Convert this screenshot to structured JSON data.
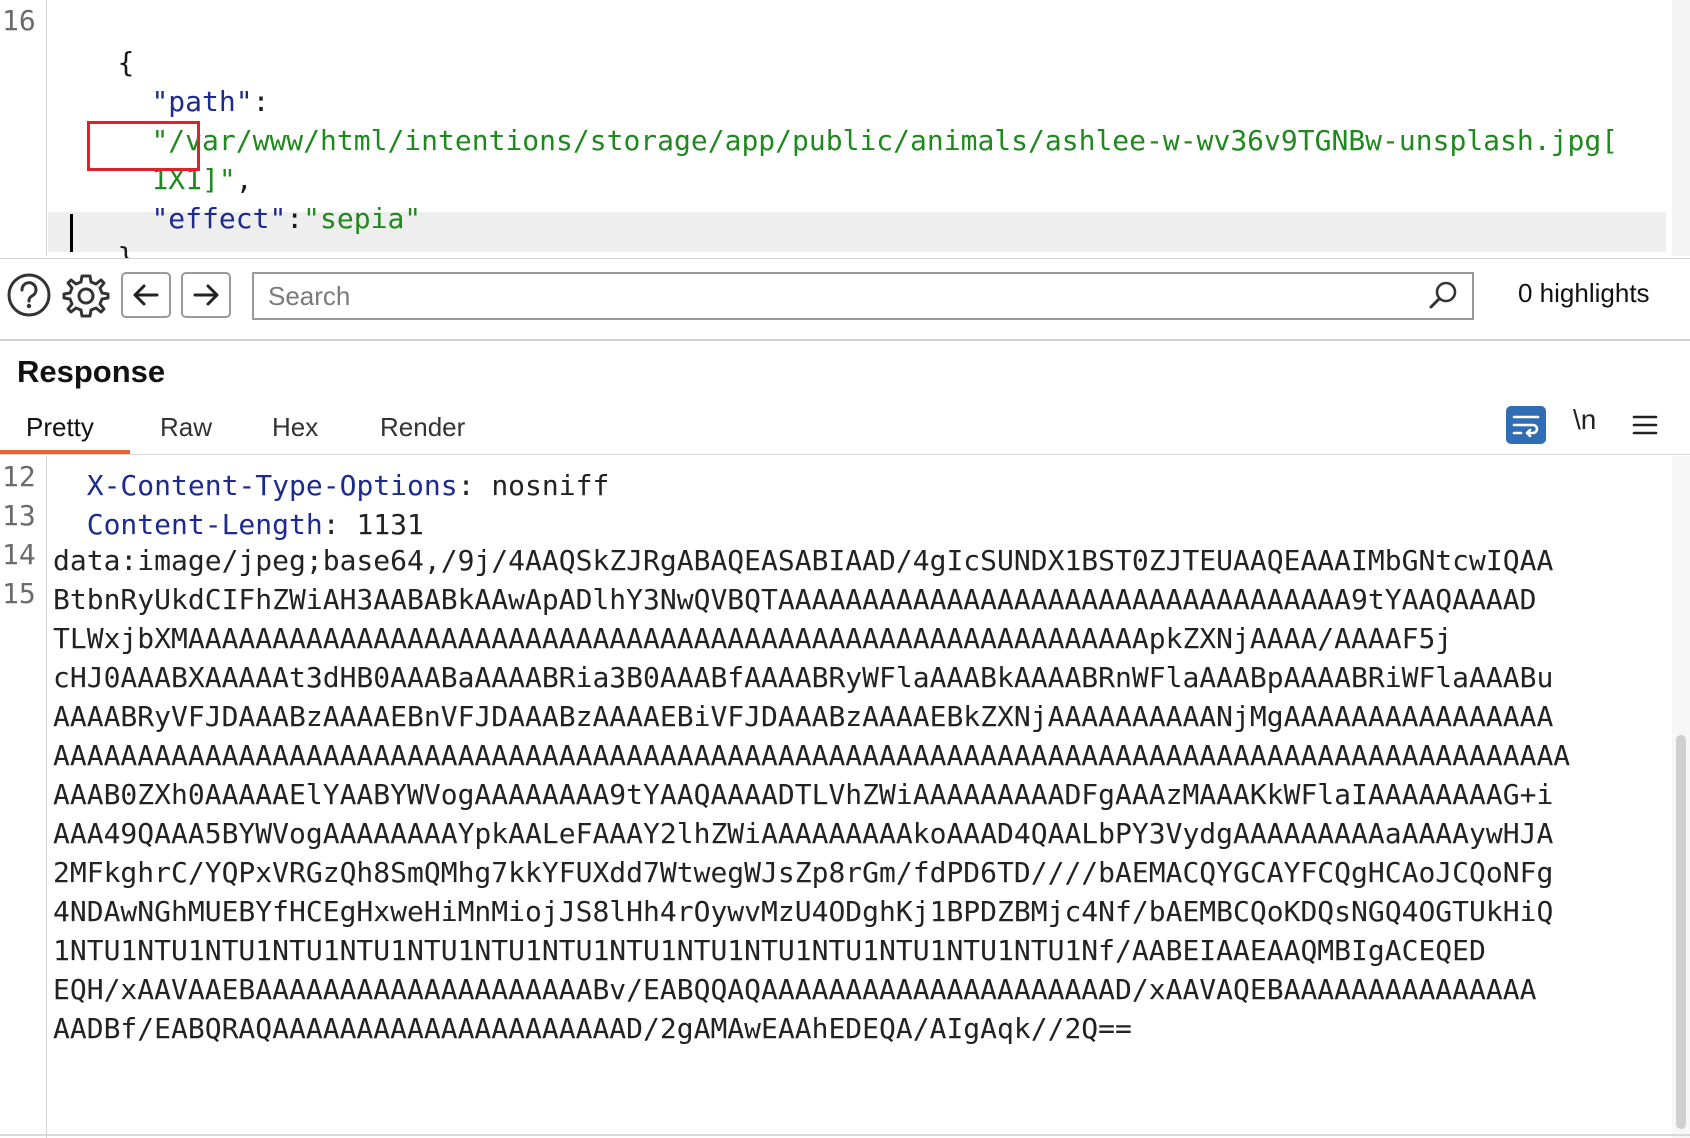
{
  "request_editor": {
    "line_number": "16",
    "lines": [
      "{",
      "\"path\":",
      "\"/var/www/html/intentions/storage/app/public/animals/ashlee-w-wv36v9TGNBw-unsplash.jpg[",
      "1X1]\",",
      "\"effect\":\"sepia\"",
      "}"
    ],
    "tokens": {
      "brace_open": "{",
      "path_key": "\"path\"",
      "colon": ":",
      "path_value_part1": "\"/var/www/html/intentions/storage/app/public/animals/ashlee-w-wv36v9TGNBw-unsplash.jpg[",
      "path_value_part2": "1X1]\"",
      "comma": ",",
      "effect_key": "\"effect\"",
      "effect_colon": ":",
      "effect_value": "\"sepia\"",
      "brace_close": "}"
    },
    "highlighted_text": "1X1]\""
  },
  "toolbar": {
    "icons": [
      "help-icon",
      "gear-icon",
      "arrow-left-icon",
      "arrow-right-icon"
    ],
    "search_placeholder": "Search",
    "search_value": "",
    "highlights_label": "0 highlights"
  },
  "response": {
    "title": "Response",
    "tabs": [
      {
        "label": "Pretty",
        "active": true
      },
      {
        "label": "Raw",
        "active": false
      },
      {
        "label": "Hex",
        "active": false
      },
      {
        "label": "Render",
        "active": false
      }
    ],
    "newline_label": "\\n",
    "lines": [
      {
        "num": "12",
        "key": "X-Content-Type-Options",
        "sep": ": ",
        "value": "nosniff"
      },
      {
        "num": "13",
        "key": "Content-Length",
        "sep": ": ",
        "value": "1131"
      },
      {
        "num": "14",
        "key": "",
        "sep": "",
        "value": ""
      },
      {
        "num": "15",
        "key": "",
        "sep": "",
        "value": ""
      }
    ],
    "body_lines": [
      "data:image/jpeg;base64,/9j/4AAQSkZJRgABAQEASABIAAD/4gIcSUNDX1BST0ZJTEUAAQEAAAIMbGNtcwIQAA",
      "BtbnRyUkdCIFhZWiAH3AABABkAAwApADlhY3NwQVBQTAAAAAAAAAAAAAAAAAAAAAAAAAAAAAAAAAA9tYAAQAAAAD",
      "TLWxjbXMAAAAAAAAAAAAAAAAAAAAAAAAAAAAAAAAAAAAAAAAAAAAAAAAAAAAAAAAApkZXNjAAAA/AAAAF5j",
      "cHJ0AAABXAAAAAt3dHB0AAABaAAAABRia3B0AAABfAAAABRyWFlaAAABkAAAABRnWFlaAAABpAAAABRiWFlaAAABu",
      "AAAABRyVFJDAAABzAAAAEBnVFJDAAABzAAAAEBiVFJDAAABzAAAAEBkZXNjAAAAAAAAAANjMgAAAAAAAAAAAAAAAA",
      "AAAAAAAAAAAAAAAAAAAAAAAAAAAAAAAAAAAAAAAAAAAAAAAAAAAAAAAAAAAAAAAAAAAAAAAAAAAAAAAAAAAAAAAAAA",
      "AAAB0ZXh0AAAAAElYAABYWVogAAAAAAAA9tYAAQAAAADTLVhZWiAAAAAAAAADFgAAAzMAAAKkWFlaIAAAAAAAAG+i",
      "AAA49QAAA5BYWVogAAAAAAAAYpkAALeFAAAY2lhZWiAAAAAAAAAkoAAAD4QAALbPY3VydgAAAAAAAAAaAAAAywHJA",
      "2MFkghrC/YQPxVRGzQh8SmQMhg7kkYFUXdd7WtwegWJsZp8rGm/fdPD6TD////bAEMACQYGCAYFCQgHCAoJCQoNFg",
      "4NDAwNGhMUEBYfHCEgHxweHiMnMiojJS8lHh4rOywvMzU4ODghKj1BPDZBMjc4Nf/bAEMBCQoKDQsNGQ4OGTUkHiQ",
      "1NTU1NTU1NTU1NTU1NTU1NTU1NTU1NTU1NTU1NTU1NTU1NTU1NTU1NTU1NTU1Nf/AABEIAAEAAQMBIgACEQED",
      "EQH/xAAVAAEBAAAAAAAAAAAAAAAAAAAABv/EABQQAQAAAAAAAAAAAAAAAAAAAAAD/xAAVAQEBAAAAAAAAAAAAAAA",
      "AADBf/EABQRAQAAAAAAAAAAAAAAAAAAAAAD/2gAMAwEAAhEDEQA/AIgAqk//2Q=="
    ]
  },
  "colors": {
    "json_key": "#1b2b8f",
    "json_string": "#1e8a1e",
    "highlight_box": "#e0202a",
    "tab_underline": "#e8632c",
    "wrap_button": "#2f6db5"
  }
}
